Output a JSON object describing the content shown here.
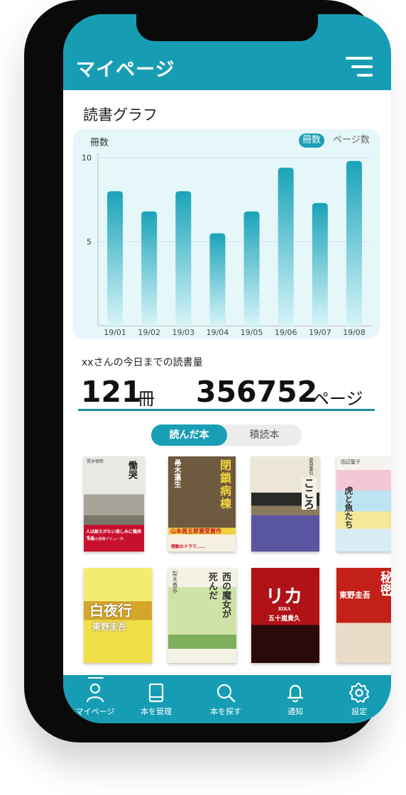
{
  "header": {
    "title": "マイページ"
  },
  "graph": {
    "section_title": "読書グラフ",
    "toggle_books": "冊数",
    "toggle_pages": "ページ数"
  },
  "chart_data": {
    "type": "bar",
    "ylabel": "冊数",
    "categories": [
      "19/01",
      "19/02",
      "19/03",
      "19/04",
      "19/05",
      "19/06",
      "19/07",
      "19/08"
    ],
    "values": [
      8,
      6.8,
      8,
      5.5,
      6.8,
      9.4,
      7.3,
      9.8
    ],
    "ylim": [
      0,
      10
    ],
    "yticks": [
      5,
      10
    ],
    "grid": true,
    "bar_color_top": "#1ba3b9",
    "bar_color_bottom": "#d6f4f8"
  },
  "stats": {
    "caption": "xxさんの今日までの読書量",
    "books_count": "121",
    "books_unit": "冊",
    "pages_count": "356752",
    "pages_unit": "ページ"
  },
  "segments": {
    "active": "読んだ本",
    "inactive": "積読本"
  },
  "books": [
    {
      "title": "慟哭",
      "author": "貫井徳郎",
      "band": "人は耐えがたい悲しみに慟哭する",
      "sub": "新鋭の衝撃デビュー作"
    },
    {
      "title": "閉鎖病棟",
      "author": "帚木蓬生",
      "band": "山本周五郎賞受賞作",
      "sub": "感動のドラマ……"
    },
    {
      "title": "こころ",
      "author": "夏目漱石"
    },
    {
      "title": "虎と魚たち",
      "author": "田辺聖子"
    },
    {
      "title": "白夜行",
      "author": "東野圭吾"
    },
    {
      "title": "西の魔女が死んだ",
      "author": "梨木香歩"
    },
    {
      "title": "リカ",
      "author": "五十嵐貴久",
      "sub": "RIKA"
    },
    {
      "title": "秘密",
      "author": "東野圭吾"
    }
  ],
  "tabs": [
    {
      "label": "マイページ",
      "icon": "user-icon"
    },
    {
      "label": "本を管理",
      "icon": "book-icon"
    },
    {
      "label": "本を探す",
      "icon": "search-icon"
    },
    {
      "label": "通知",
      "icon": "bell-icon"
    },
    {
      "label": "設定",
      "icon": "gear-icon"
    }
  ],
  "colors": {
    "accent": "#169db4",
    "phone": "#0a0a0a"
  }
}
